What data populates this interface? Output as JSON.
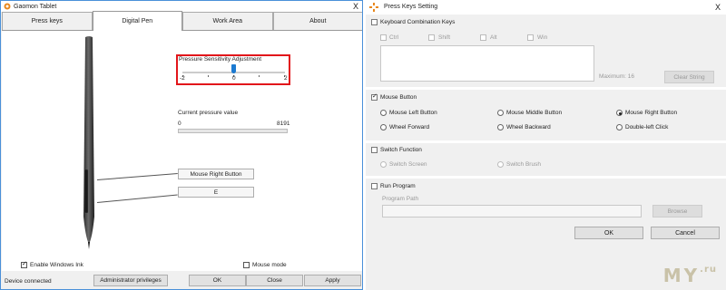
{
  "left": {
    "title": "Gaomon Tablet",
    "close_glyph": "X",
    "tabs": [
      "Press keys",
      "Digital Pen",
      "Work Area",
      "About"
    ],
    "active_tab": 1,
    "pressure": {
      "label": "Pressure Sensitivity Adjustment",
      "min_label": "-2",
      "mid_label": "0",
      "max_label": "2",
      "value": 0
    },
    "current_pressure": {
      "label": "Current pressure value",
      "min_label": "0",
      "max_label": "8191",
      "value": 0
    },
    "pen_buttons": {
      "upper": "Mouse Right Button",
      "lower": "E"
    },
    "enable_windows_ink": {
      "label": "Enable Windows Ink",
      "checked": true
    },
    "mouse_mode": {
      "label": "Mouse mode",
      "checked": false
    },
    "status": "Device connected",
    "admin_button": "Administrator privileges",
    "ok_button": "OK",
    "close_button": "Close",
    "apply_button": "Apply"
  },
  "right": {
    "title": "Press Keys Setting",
    "close_glyph": "X",
    "keyboard": {
      "label": "Keyboard Combination Keys",
      "checked": false,
      "modifiers": [
        "Ctrl",
        "Shift",
        "Alt",
        "Win"
      ],
      "maximum_label": "Maximum: 16",
      "clear_button": "Clear String"
    },
    "mouse": {
      "label": "Mouse Button",
      "checked": true,
      "options": [
        "Mouse Left Button",
        "Mouse Middle Button",
        "Mouse Right Button",
        "Wheel Forward",
        "Wheel Backward",
        "Double-left Click"
      ],
      "selected": "Mouse Right Button"
    },
    "switch_function": {
      "label": "Switch Function",
      "checked": false,
      "options": [
        "Switch Screen",
        "Switch Brush"
      ]
    },
    "run_program": {
      "label": "Run Program",
      "checked": false,
      "path_label": "Program Path",
      "browse_button": "Browse"
    },
    "ok_button": "OK",
    "cancel_button": "Cancel",
    "watermark_main": "MY",
    "watermark_sub": ".ru"
  },
  "colors": {
    "accent_blue": "#1b7ad1",
    "highlight_red": "#e2151a",
    "window_border": "#4a90d9"
  }
}
